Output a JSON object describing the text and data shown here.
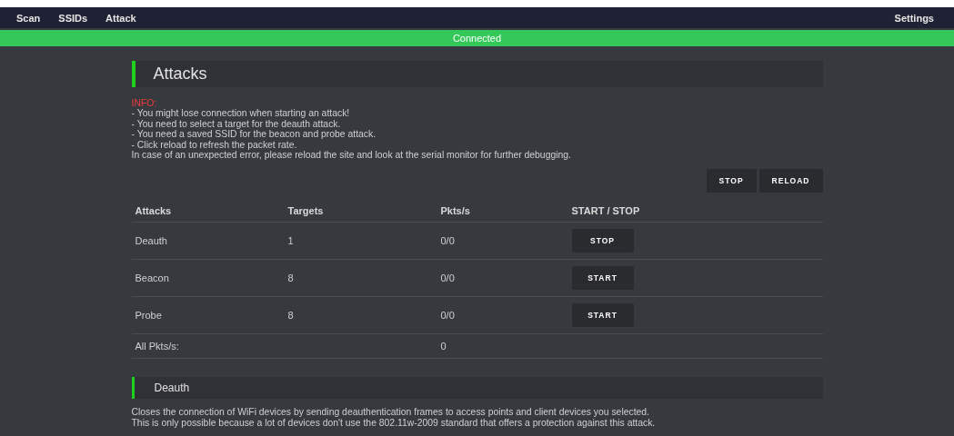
{
  "nav": {
    "left": [
      "Scan",
      "SSIDs",
      "Attack"
    ],
    "right": "Settings"
  },
  "status": "Connected",
  "title": "Attacks",
  "info": {
    "label": "INFO:",
    "lines": [
      "- You might lose connection when starting an attack!",
      "- You need to select a target for the deauth attack.",
      "- You need a saved SSID for the beacon and probe attack.",
      "- Click reload to refresh the packet rate.",
      "In case of an unexpected error, please reload the site and look at the serial monitor for further debugging."
    ]
  },
  "actions": [
    "STOP",
    "RELOAD"
  ],
  "table": {
    "columns": [
      "Attacks",
      "Targets",
      "Pkts/s",
      "START / STOP"
    ],
    "rows": [
      {
        "attack": "Deauth",
        "targets": "1",
        "pkts": "0/0",
        "button": "STOP"
      },
      {
        "attack": "Beacon",
        "targets": "8",
        "pkts": "0/0",
        "button": "START"
      },
      {
        "attack": "Probe",
        "targets": "8",
        "pkts": "0/0",
        "button": "START"
      }
    ],
    "total": {
      "label": "All Pkts/s:",
      "value": "0"
    }
  },
  "section": {
    "title": "Deauth",
    "lines": [
      "Closes the connection of WiFi devices by sending deauthentication frames to access points and client devices you selected.",
      "This is only possible because a lot of devices don't use the 802.11w-2009 standard that offers a protection against this attack."
    ]
  }
}
